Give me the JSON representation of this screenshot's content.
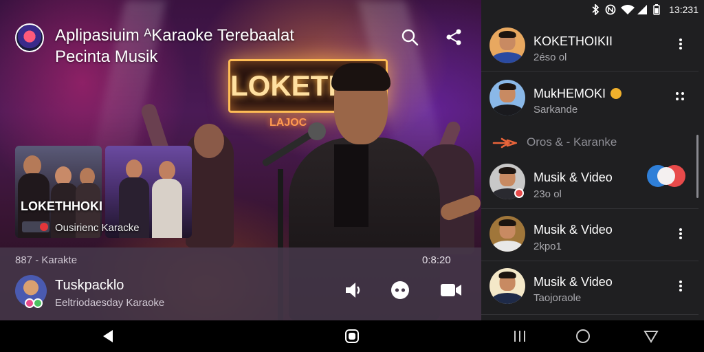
{
  "header": {
    "title": "Aplipasiuim ᴬKaraoke Terebaalat\nPecinta Musik",
    "search_icon": "search-icon",
    "share_icon": "share-icon"
  },
  "stage": {
    "sign_text": "LOKETHOKI",
    "sign_sub": "LAJOC"
  },
  "thumbnail": {
    "title": "LOKETHHOKI",
    "caption": "Ousirienc Karacke"
  },
  "player": {
    "label": "887 - Karakte",
    "time": "0:8:20",
    "name": "Tuskpacklo",
    "subtitle": "Eeltriodaesday Karaoke"
  },
  "status_bar": {
    "time": "13:231"
  },
  "panel": {
    "rows": [
      {
        "title": "KOKETHOIKII",
        "subtitle": "2éso ol"
      },
      {
        "title": "MukHEMOKI",
        "subtitle": "Sarkande"
      },
      {
        "title": "Musik & Video",
        "subtitle": "23o ol"
      },
      {
        "title": "Musik & Video",
        "subtitle": "2kpo1"
      },
      {
        "title": "Musik & Video",
        "subtitle": "Taojoraole"
      }
    ],
    "section_label": "Oros & - Karanke",
    "toggle_state": "on"
  },
  "colors": {
    "accent_blue": "#2f7fd8",
    "accent_red": "#e84a4a",
    "panel_bg": "#1f1f21",
    "badge_orange": "#f0b02c"
  }
}
